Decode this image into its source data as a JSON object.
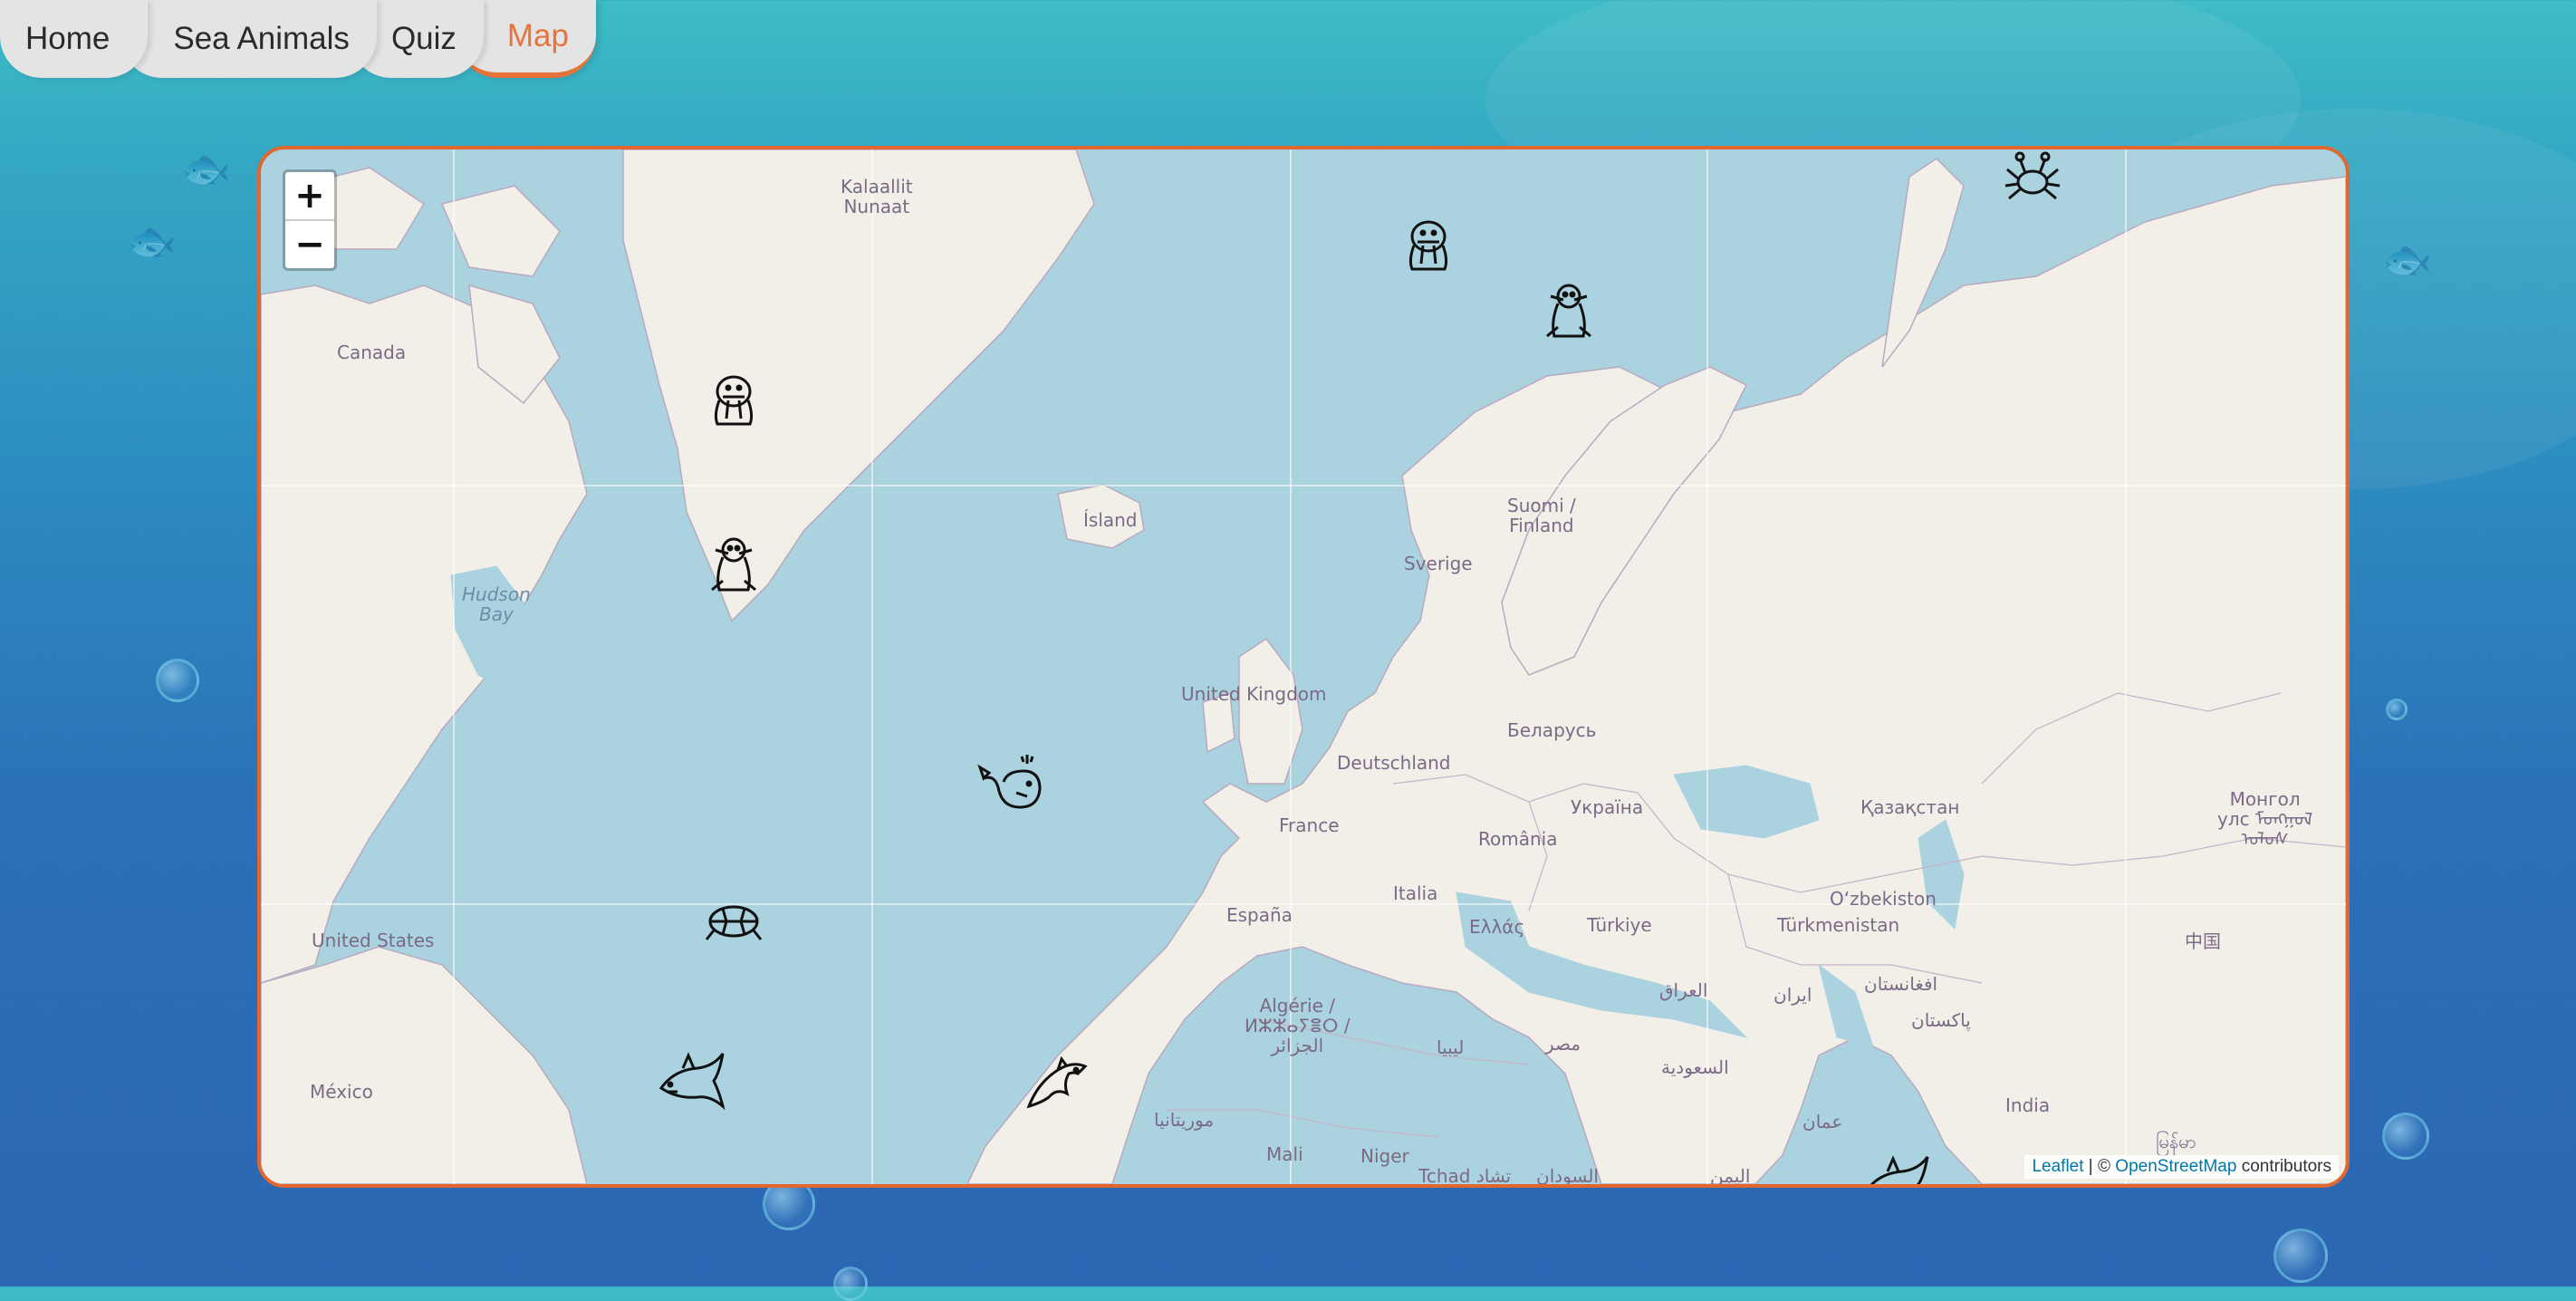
{
  "nav": {
    "items": [
      {
        "label": "Home"
      },
      {
        "label": "Sea Animals"
      },
      {
        "label": "Quiz"
      },
      {
        "label": "Map"
      }
    ],
    "active": "Map",
    "accent_color": "#e8743b"
  },
  "map": {
    "zoom_in": "+",
    "zoom_out": "−",
    "labels": {
      "kalaallit": "Kalaallit\nNunaat",
      "canada": "Canada",
      "hudson": "Hudson\nBay",
      "island": "Ísland",
      "suomi": "Suomi /\nFinland",
      "sverige": "Sverige",
      "uk": "United Kingdom",
      "belarus": "Беларусь",
      "deutschland": "Deutschland",
      "ukraina": "Україна",
      "kazakhstan": "Қазақстан",
      "mongol": "Монгол\nулс ᠮᠣᠩᠭᠣᠯ\nᠤᠯᠤᠰ",
      "france": "France",
      "romania": "România",
      "espana": "España",
      "italia": "Italia",
      "uzbekiston": "O‘zbekiston",
      "turkiye": "Türkiye",
      "ellas": "Ελλάς",
      "turkmenistan": "Türkmenistan",
      "usa": "United States",
      "china": "中国",
      "iraq": "العراق",
      "iran": "ایران",
      "afghanistan": "افغانستان",
      "pakistan": "پاکستان",
      "algerie": "Algérie /\nⵍⵣⵣⴰⵢⴻⵔ /\nالجزائر",
      "libya": "ليبيا",
      "misr": "مصر",
      "saudi": "السعودية",
      "mexico": "México",
      "india": "India",
      "mauritania": "موريتانيا",
      "mali": "Mali",
      "niger": "Niger",
      "tchad": "Tchad تشاد",
      "sudan": "السودان",
      "oman": "عمان",
      "yemen": "اليمن",
      "myanmar": "မြန်မာ"
    },
    "attribution": {
      "leaflet": "Leaflet",
      "separator": "| ©",
      "osm": "OpenStreetMap",
      "suffix": "contributors"
    },
    "markers": [
      {
        "name": "walrus-marker-greenland",
        "icon": "walrus"
      },
      {
        "name": "seal-marker-baffin",
        "icon": "seal"
      },
      {
        "name": "walrus-marker-svalbard",
        "icon": "walrus"
      },
      {
        "name": "seal-marker-norway-sea",
        "icon": "seal"
      },
      {
        "name": "crab-marker-arctic",
        "icon": "crab"
      },
      {
        "name": "whale-marker-atlantic",
        "icon": "whale"
      },
      {
        "name": "turtle-marker-atlantic",
        "icon": "turtle"
      },
      {
        "name": "shark-marker-caribbean",
        "icon": "shark"
      },
      {
        "name": "dolphin-marker-atlantic",
        "icon": "dolphin"
      },
      {
        "name": "shark-marker-arabian-sea",
        "icon": "shark"
      }
    ],
    "colors": {
      "water": "#aad3df",
      "land": "#f2efe9",
      "border": "#e0672f"
    }
  }
}
